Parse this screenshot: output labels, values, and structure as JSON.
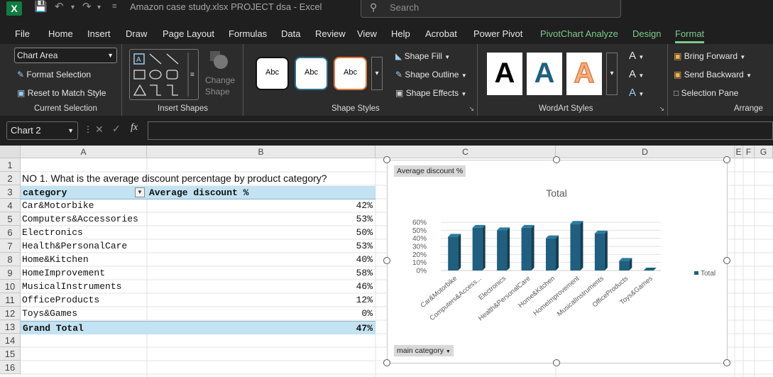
{
  "titlebar": {
    "app_icon": "X",
    "document_title": "Amazon case study.xlsx PROJECT dsa  -  Excel",
    "search_placeholder": "Search"
  },
  "menu": [
    "File",
    "Home",
    "Insert",
    "Draw",
    "Page Layout",
    "Formulas",
    "Data",
    "Review",
    "View",
    "Help",
    "Acrobat",
    "Power Pivot",
    "PivotChart Analyze",
    "Design",
    "Format"
  ],
  "ribbon": {
    "current_selection": {
      "combo_value": "Chart Area",
      "format_selection": "Format Selection",
      "reset": "Reset to Match Style",
      "label": "Current Selection"
    },
    "insert_shapes": {
      "change_shape": "Change",
      "change_shape2": "Shape",
      "label": "Insert Shapes"
    },
    "shape_styles": {
      "styles": [
        "Abc",
        "Abc",
        "Abc"
      ],
      "fill": "Shape Fill",
      "outline": "Shape Outline",
      "effects": "Shape Effects",
      "label": "Shape Styles"
    },
    "wordart": {
      "letters": [
        "A",
        "A",
        "A"
      ],
      "label": "WordArt Styles"
    },
    "arrange": {
      "bring_forward": "Bring Forward",
      "send_backward": "Send Backward",
      "selection_pane": "Selection Pane",
      "label": "Arrange"
    }
  },
  "formula_bar": {
    "name_box": "Chart 2",
    "fx": "fx",
    "formula": ""
  },
  "columns": [
    "A",
    "B",
    "C",
    "D",
    "E",
    "F",
    "G"
  ],
  "rows": [
    "1",
    "2",
    "3",
    "4",
    "5",
    "6",
    "7",
    "8",
    "9",
    "10",
    "11",
    "12",
    "13",
    "14",
    "15",
    "16"
  ],
  "sheet": {
    "question": "NO 1. What is the average discount percentage by product category?",
    "header": {
      "category": "category",
      "value": "Average discount %"
    },
    "data": [
      {
        "category": "Car&Motorbike",
        "value": "42%"
      },
      {
        "category": "Computers&Accessories",
        "value": "53%"
      },
      {
        "category": "Electronics",
        "value": "50%"
      },
      {
        "category": "Health&PersonalCare",
        "value": "53%"
      },
      {
        "category": "Home&Kitchen",
        "value": "40%"
      },
      {
        "category": "HomeImprovement",
        "value": "58%"
      },
      {
        "category": "MusicalInstruments",
        "value": "46%"
      },
      {
        "category": "OfficeProducts",
        "value": "12%"
      },
      {
        "category": "Toys&Games",
        "value": "0%"
      }
    ],
    "total": {
      "label": "Grand Total",
      "value": "47%"
    }
  },
  "chart_data": {
    "type": "bar",
    "title": "Total",
    "value_field_button": "Average discount %",
    "axis_field_button": "main category",
    "categories": [
      "Car&Motorbike",
      "Computers&Access...",
      "Electronics",
      "Health&PersonalCare",
      "Home&Kitchen",
      "HomeImprovement",
      "MusicalInstruments",
      "OfficeProducts",
      "Toys&Games"
    ],
    "series": [
      {
        "name": "Total",
        "values": [
          42,
          53,
          50,
          53,
          40,
          58,
          46,
          12,
          0
        ]
      }
    ],
    "yticks": [
      "0%",
      "10%",
      "20%",
      "30%",
      "40%",
      "50%",
      "60%"
    ],
    "ylim": [
      0,
      60
    ],
    "legend": "right",
    "bar_color": "#1f5f7f"
  }
}
